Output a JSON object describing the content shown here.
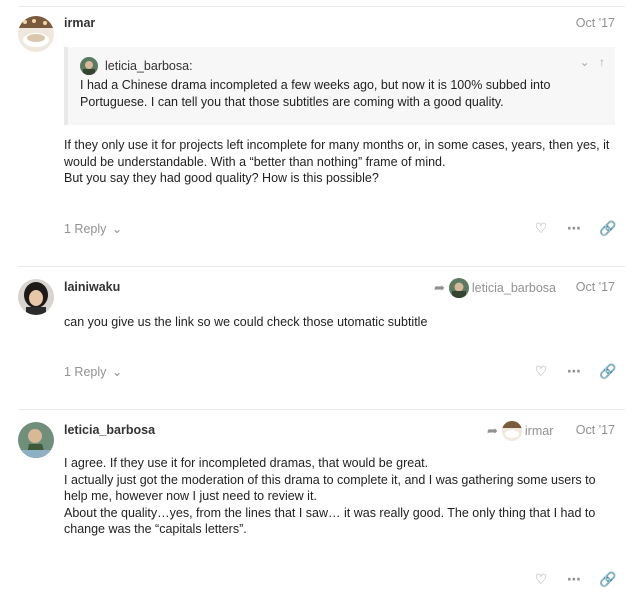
{
  "posts": [
    {
      "username": "irmar",
      "date": "Oct '17",
      "quote": {
        "author": "leticia_barbosa:",
        "text": "I had a Chinese drama incompleted a few weeks ago, but now it is 100% subbed into Portuguese. I can tell you that those subtitles are coming with a good quality."
      },
      "paragraphs": [
        "If they only use it for projects left incomplete for many months or, in some cases, years, then yes, it would be understandable. With a “better than nothing” frame of mind.",
        "But you say they had good quality? How is this possible?"
      ],
      "replies": "1 Reply"
    },
    {
      "username": "lainiwaku",
      "date": "Oct '17",
      "reply_to": "leticia_barbosa",
      "paragraphs": [
        "can you give us the link so we could check those utomatic subtitle"
      ],
      "replies": "1 Reply"
    },
    {
      "username": "leticia_barbosa",
      "date": "Oct '17",
      "reply_to": "irmar",
      "paragraphs": [
        "I agree. If they use it for incompleted dramas, that would be great.",
        "I actually just got the moderation of this drama to complete it, and I was gathering some users to help me, however now I just need to review it.",
        "About the quality…yes, from the lines that I saw… it was really good. The only thing that I had to change was the “capitals letters”."
      ]
    }
  ],
  "icons": {
    "like": "heart-icon",
    "more": "ellipsis-icon",
    "share": "link-icon",
    "reply_arrow": "reply-arrow-icon",
    "expand": "chevron-down-icon",
    "collapse": "arrow-up-icon"
  }
}
